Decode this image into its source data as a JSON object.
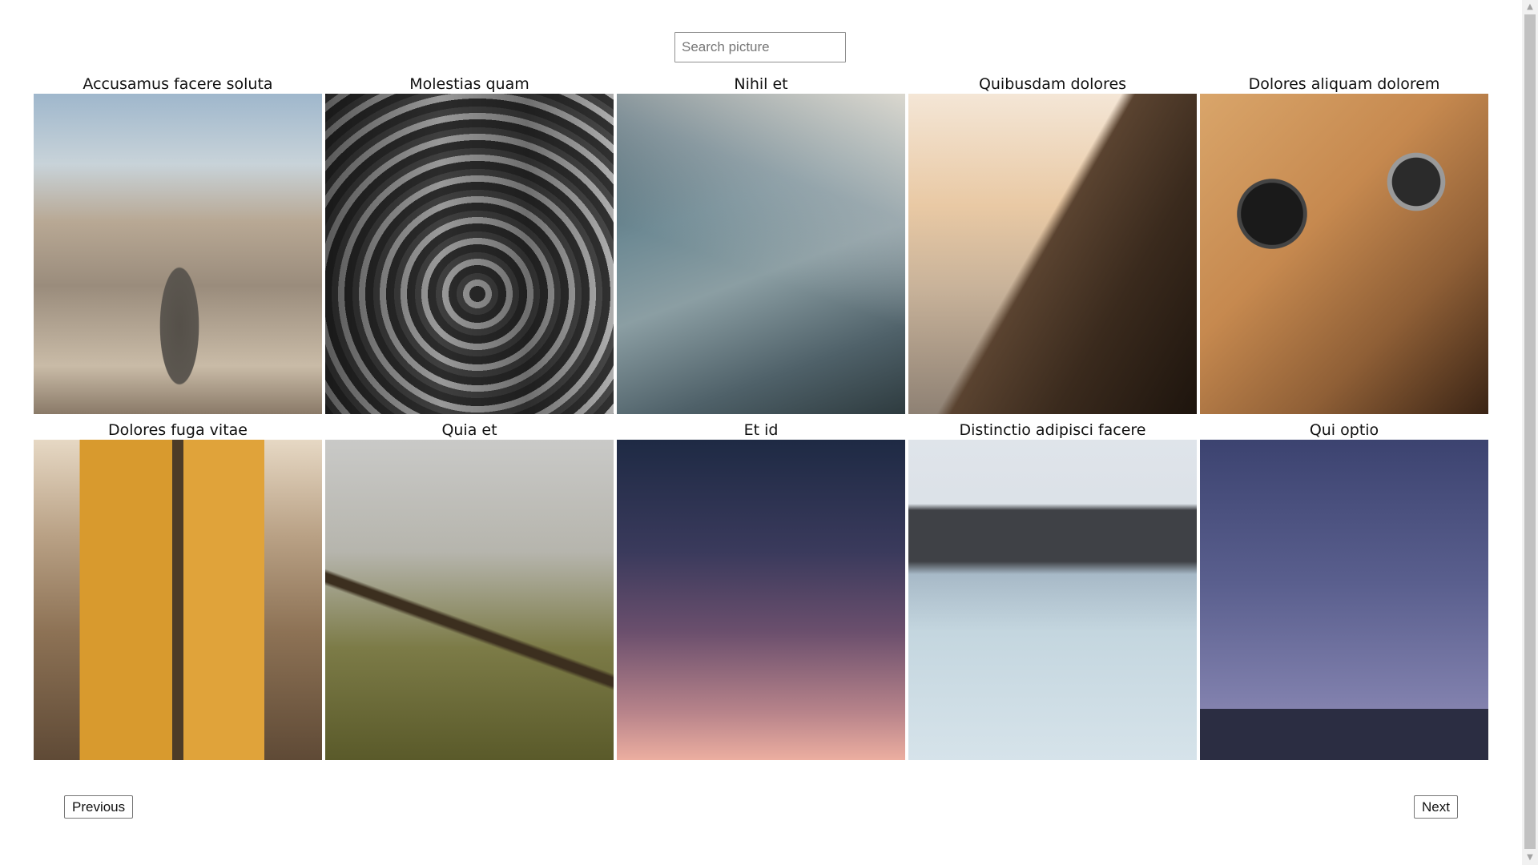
{
  "search": {
    "placeholder": "Search picture",
    "value": ""
  },
  "gallery": {
    "items": [
      {
        "title": "Accusamus facere soluta"
      },
      {
        "title": "Molestias quam"
      },
      {
        "title": "Nihil et"
      },
      {
        "title": "Quibusdam dolores"
      },
      {
        "title": "Dolores aliquam dolorem"
      },
      {
        "title": "Dolores fuga vitae"
      },
      {
        "title": "Quia et"
      },
      {
        "title": "Et id"
      },
      {
        "title": "Distinctio adipisci facere"
      },
      {
        "title": "Qui optio"
      }
    ]
  },
  "pagination": {
    "previous_label": "Previous",
    "next_label": "Next"
  },
  "scrollbar": {
    "up_icon": "triangle-up",
    "down_icon": "triangle-down"
  }
}
